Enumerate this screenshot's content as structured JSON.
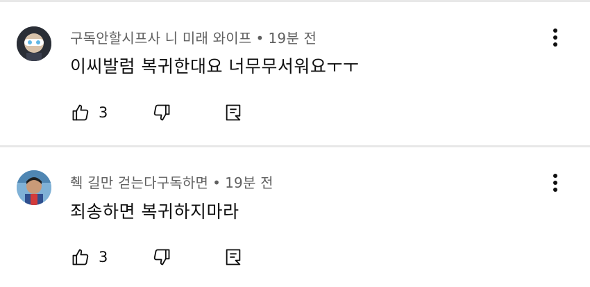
{
  "comments": [
    {
      "author": "구독안할시프사 니 미래 와이프",
      "separator": "•",
      "time": "19분 전",
      "text": "이씨발럼 복귀한대요 너무무서워요ㅜㅜ",
      "likes": "3",
      "avatar_icon": "avatar-white-glasses"
    },
    {
      "author": "췍 길만 걷는다구독하면",
      "separator": "•",
      "time": "19분 전",
      "text": "죄송하면 복귀하지마라",
      "likes": "3",
      "avatar_icon": "avatar-photo-blue"
    }
  ],
  "icons": {
    "like": "thumbs-up-icon",
    "dislike": "thumbs-down-icon",
    "reply": "reply-icon",
    "menu": "more-vert-icon"
  },
  "colors": {
    "meta": "#606060",
    "text": "#0f0f0f",
    "divider": "#e8e8e8"
  }
}
